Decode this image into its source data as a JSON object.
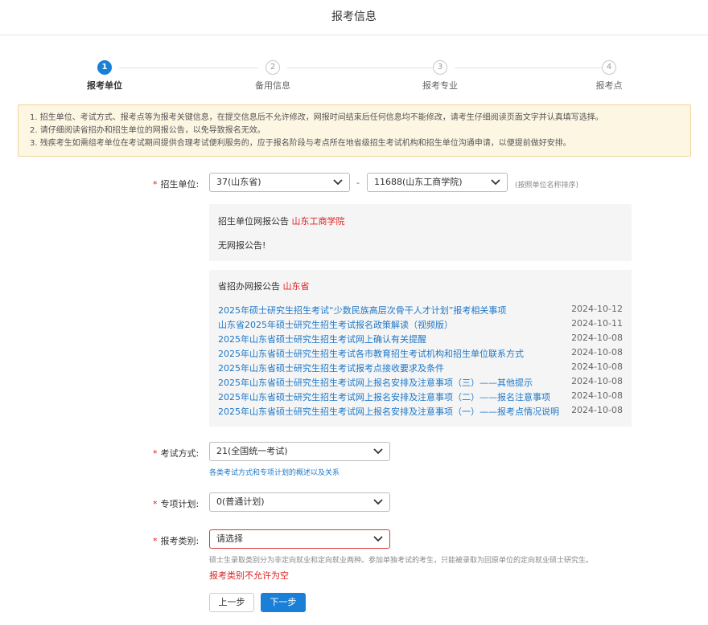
{
  "header": {
    "title": "报考信息"
  },
  "steps": [
    {
      "num": "1",
      "label": "报考单位"
    },
    {
      "num": "2",
      "label": "备用信息"
    },
    {
      "num": "3",
      "label": "报考专业"
    },
    {
      "num": "4",
      "label": "报考点"
    }
  ],
  "notice": [
    "1. 招生单位、考试方式、报考点等为报考关键信息，在提交信息后不允许修改，网报时间结束后任何信息均不能修改，请考生仔细阅读页面文字并认真填写选择。",
    "2. 请仔细阅读省招办和招生单位的网报公告，以免导致报名无效。",
    "3. 残疾考生如需组考单位在考试期间提供合理考试便利服务的，应于报名阶段与考点所在地省级招生考试机构和招生单位沟通申请，以便提前做好安排。"
  ],
  "form": {
    "unit": {
      "required": "*",
      "label": "招生单位:",
      "province": "37(山东省)",
      "dash": "-",
      "school": "11688(山东工商学院)",
      "hint": "(按照单位名称排序)"
    },
    "unit_notice": {
      "title": "招生单位网报公告",
      "school": "山东工商学院",
      "content": "无网报公告!"
    },
    "province_notice": {
      "title": "省招办网报公告",
      "province": "山东省",
      "items": [
        {
          "title": "2025年硕士研究生招生考试“少数民族高层次骨干人才计划”报考相关事项",
          "date": "2024-10-12"
        },
        {
          "title": "山东省2025年硕士研究生招生考试报名政策解读（视频版）",
          "date": "2024-10-11"
        },
        {
          "title": "2025年山东省硕士研究生招生考试网上确认有关提醒",
          "date": "2024-10-08"
        },
        {
          "title": "2025年山东省硕士研究生招生考试各市教育招生考试机构和招生单位联系方式",
          "date": "2024-10-08"
        },
        {
          "title": "2025年山东省硕士研究生招生考试报考点接收要求及条件",
          "date": "2024-10-08"
        },
        {
          "title": "2025年山东省硕士研究生招生考试网上报名安排及注意事项（三）——其他提示",
          "date": "2024-10-08"
        },
        {
          "title": "2025年山东省硕士研究生招生考试网上报名安排及注意事项（二）——报名注意事项",
          "date": "2024-10-08"
        },
        {
          "title": "2025年山东省硕士研究生招生考试网上报名安排及注意事项（一）——报考点情况说明",
          "date": "2024-10-08"
        }
      ]
    },
    "exam_method": {
      "required": "*",
      "label": "考试方式:",
      "value": "21(全国统一考试)",
      "link": "各类考试方式和专项计划的概述以及关系"
    },
    "special_plan": {
      "required": "*",
      "label": "专项计划:",
      "value": "0(普通计划)"
    },
    "category": {
      "required": "*",
      "label": "报考类别:",
      "value": "请选择",
      "hint": "硕士生录取类别分为非定向就业和定向就业两种。参加单独考试的考生，只能被录取为回原单位的定向就业硕士研究生。",
      "error": "报考类别不允许为空"
    }
  },
  "buttons": {
    "prev": "上一步",
    "next": "下一步"
  },
  "colors": {
    "primary": "#1a7fd6",
    "error": "#e02020",
    "link": "#1e78c8",
    "notice_bg": "#fdf6e3"
  }
}
